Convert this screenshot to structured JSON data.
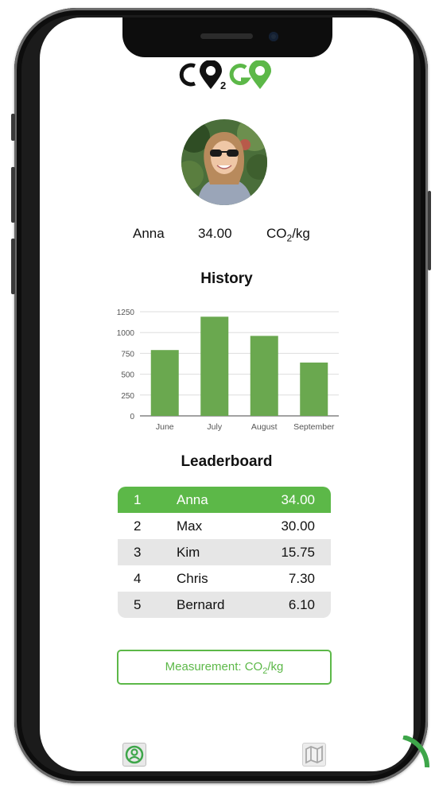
{
  "app": {
    "logo_text": "CO2GO",
    "accent_color": "#5cb848"
  },
  "profile": {
    "name": "Anna",
    "score": "34.00",
    "unit_main": "CO",
    "unit_sub": "2",
    "unit_tail": "/kg"
  },
  "history": {
    "title": "History",
    "chart_data": {
      "type": "bar",
      "categories": [
        "June",
        "July",
        "August",
        "September"
      ],
      "values": [
        790,
        1190,
        960,
        640
      ],
      "ylim": [
        0,
        1250
      ],
      "yticks": [
        0,
        250,
        500,
        750,
        1000,
        1250
      ],
      "grid": true,
      "color": "#6aa84f"
    }
  },
  "leaderboard": {
    "title": "Leaderboard",
    "rows": [
      {
        "rank": "1",
        "name": "Anna",
        "score": "34.00"
      },
      {
        "rank": "2",
        "name": "Max",
        "score": "30.00"
      },
      {
        "rank": "3",
        "name": "Kim",
        "score": "15.75"
      },
      {
        "rank": "4",
        "name": "Chris",
        "score": "7.30"
      },
      {
        "rank": "5",
        "name": "Bernard",
        "score": "6.10"
      }
    ]
  },
  "measurement_button": {
    "label_prefix": "Measurement: CO",
    "label_sub": "2",
    "label_suffix": "/kg"
  },
  "nav": {
    "profile_icon": "profile-icon",
    "map_icon": "map-icon"
  }
}
